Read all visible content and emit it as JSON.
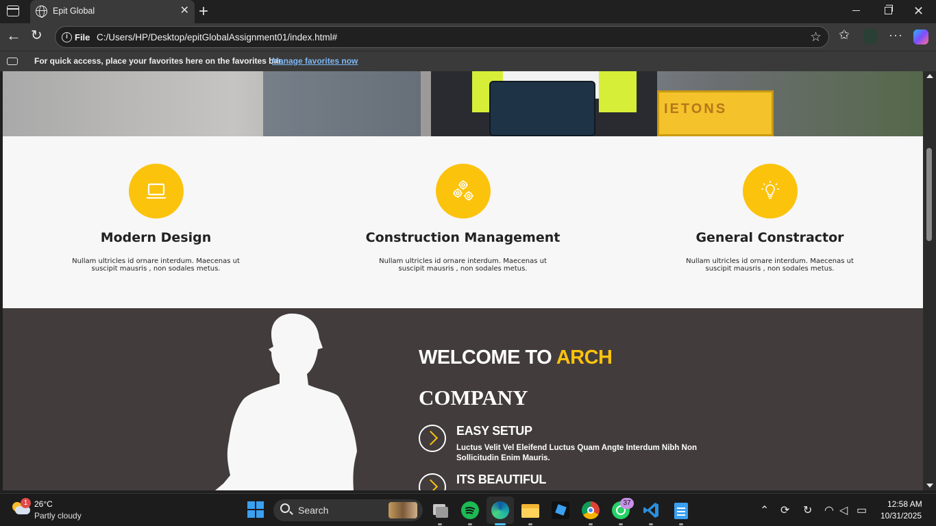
{
  "browser": {
    "tab_title": "Epit Global",
    "tab_close": "✕",
    "new_tab": "+",
    "file_label": "File",
    "url": "C:/Users/HP/Desktop/epitGlobalAssignment01/index.html#",
    "favorites_prompt": "For quick access, place your favorites here on the favorites bar.",
    "favorites_link": "Manage favorites now",
    "icons": [
      "sidebar-icon",
      "globe-icon",
      "close-icon",
      "plus-icon",
      "back-icon",
      "reload-icon",
      "info-icon",
      "star-icon",
      "favorites-icon",
      "profile-icon",
      "more-icon",
      "copilot-icon"
    ]
  },
  "hero": {
    "sign_text": "IETONS"
  },
  "features": [
    {
      "icon": "laptop-icon",
      "title": "Modern Design",
      "text": "Nullam ultricles id ornare interdum. Maecenas ut suscipit mausris , non sodales metus."
    },
    {
      "icon": "gears-icon",
      "title": "Construction Management",
      "text": "Nullam ultricles id ornare interdum. Maecenas ut suscipit mausris , non sodales metus."
    },
    {
      "icon": "lightbulb-icon",
      "title": "General Constractor",
      "text": "Nullam ultricles id ornare interdum. Maecenas ut suscipit mausris , non sodales metus."
    }
  ],
  "about": {
    "welcome_prefix": "WELCOME TO ",
    "welcome_accent": "ARCH",
    "company": "COMPANY",
    "items": [
      {
        "title": "EASY SETUP",
        "text": "Luctus Velit Vel Eleifend Luctus Quam Angte Interdum Nibh Non Sollicitudin Enim Mauris."
      },
      {
        "title": "ITS BEAUTIFUL",
        "text": ""
      }
    ]
  },
  "colors": {
    "accent": "#fcc30d",
    "about_bg": "#433c3c",
    "features_bg": "#f7f7f7"
  },
  "taskbar": {
    "weather_badge": "1",
    "temperature": "26°C",
    "weather": "Partly cloudy",
    "search_label": "Search",
    "whatsapp_badge": "37",
    "time": "12:58 AM",
    "date": "10/31/2025"
  }
}
